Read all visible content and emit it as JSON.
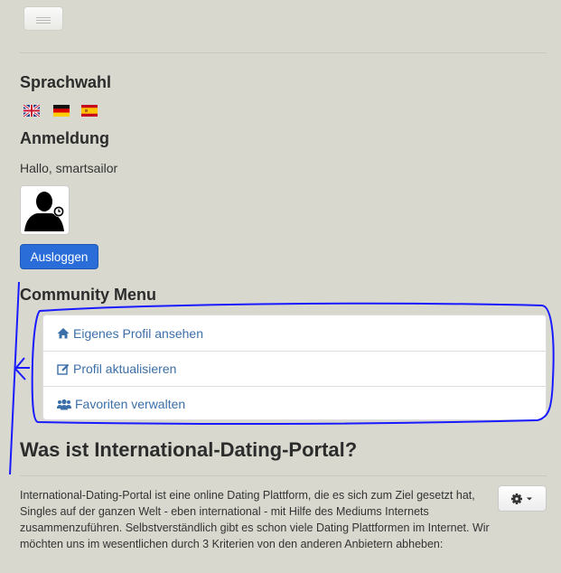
{
  "language_section": {
    "heading": "Sprachwahl",
    "flags": [
      "flag-uk-icon",
      "flag-de-icon",
      "flag-es-icon"
    ]
  },
  "login_section": {
    "heading": "Anmeldung",
    "greeting": "Hallo, smartsailor",
    "logout_label": "Ausloggen"
  },
  "community_menu": {
    "heading": "Community Menu",
    "items": [
      {
        "label": "Eigenes Profil ansehen",
        "icon": "home-icon"
      },
      {
        "label": "Profil aktualisieren",
        "icon": "edit-icon"
      },
      {
        "label": "Favoriten verwalten",
        "icon": "users-icon"
      }
    ]
  },
  "about": {
    "heading": "Was ist International-Dating-Portal?",
    "lines": [
      "International-Dating-Portal ist eine online Dating Plattform, die es sich zum Ziel gesetzt hat,",
      "Singles auf der ganzen Welt - eben international - mit Hilfe des Mediums Internets",
      "zusammenzuführen. Selbstverständlich gibt es schon viele Dating Plattformen im Internet. Wir",
      "möchten uns im wesentlichen durch 3 Kriterien von den anderen Anbietern abheben:"
    ]
  },
  "colors": {
    "background": "#d8d8cf",
    "primary_button": "#2a6dd9",
    "link": "#3b6fa8",
    "annotation": "#1a1aff"
  }
}
